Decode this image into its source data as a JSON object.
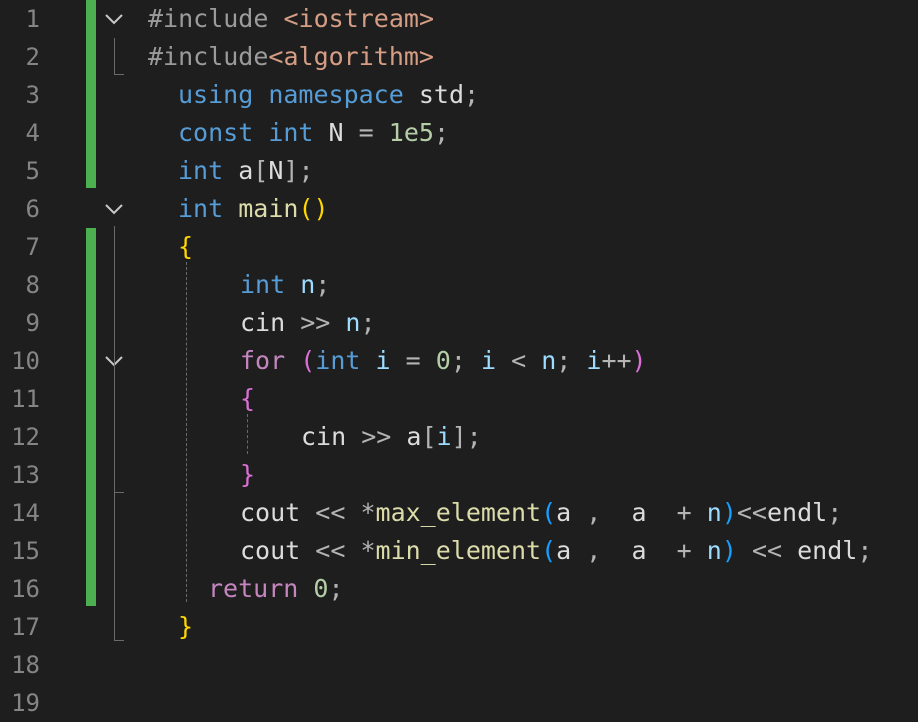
{
  "editor": {
    "line_numbers": [
      "1",
      "2",
      "3",
      "4",
      "5",
      "6",
      "7",
      "8",
      "9",
      "10",
      "11",
      "12",
      "13",
      "14",
      "15",
      "16",
      "17",
      "18",
      "19"
    ]
  },
  "colors": {
    "background": "#1e1e1e",
    "line_number": "#858585",
    "change_bar": "#4caf50",
    "keyword": "#569cd6",
    "control_keyword": "#c586c0",
    "function": "#dcdcaa",
    "variable": "#9cdcfe",
    "number": "#b5cea8",
    "string": "#d69d85",
    "bracket_level1": "#ffd700",
    "bracket_level3": "#179fff"
  },
  "icons": {
    "fold": "chevron-down-icon"
  },
  "code": {
    "l1": {
      "directive": "#include",
      "header": "<iostream>"
    },
    "l2": {
      "directive": "#include",
      "header": "<algorithm>"
    },
    "l3": {
      "kw_using": "using",
      "kw_namespace": "namespace",
      "name": "std",
      "semi": ";"
    },
    "l4": {
      "kw_const": "const",
      "kw_int": "int",
      "name": "N",
      "op": "=",
      "value": "1e5",
      "semi": ";"
    },
    "l5": {
      "kw_int": "int",
      "name": "a",
      "lb": "[",
      "size": "N",
      "rb": "]",
      "semi": ";"
    },
    "l6": {
      "kw_int": "int",
      "fn": "main",
      "parens": "()"
    },
    "l7": {
      "brace": "{"
    },
    "l8": {
      "kw_int": "int",
      "name": "n",
      "semi": ";"
    },
    "l9": {
      "obj": "cin",
      "op": ">>",
      "name": "n",
      "semi": ";"
    },
    "l10": {
      "kw_for": "for",
      "lp": "(",
      "kw_int": "int",
      "i1": "i",
      "eq": "=",
      "zero": "0",
      "semi1": ";",
      "i2": "i",
      "lt": "<",
      "n": "n",
      "semi2": ";",
      "i3": "i",
      "inc": "++",
      "rp": ")"
    },
    "l11": {
      "brace": "{"
    },
    "l12": {
      "obj": "cin",
      "op": ">>",
      "arr": "a",
      "lb": "[",
      "idx": "i",
      "rb": "]",
      "semi": ";"
    },
    "l13": {
      "brace": "}"
    },
    "l14": {
      "obj": "cout",
      "op": "<<",
      "star": "*",
      "fn": "max_element",
      "lp": "(",
      "a1": "a",
      "comma": ",",
      "a2": "a",
      "plus": "+",
      "n": "n",
      "rp": ")",
      "op2": "<<",
      "endl": "endl",
      "semi": ";"
    },
    "l15": {
      "obj": "cout",
      "op": "<<",
      "star": "*",
      "fn": "min_element",
      "lp": "(",
      "a1": "a",
      "comma": ",",
      "a2": "a",
      "plus": "+",
      "n": "n",
      "rp": ")",
      "op2": "<<",
      "endl": "endl",
      "semi": ";"
    },
    "l16": {
      "kw_return": "return",
      "zero": "0",
      "semi": ";"
    },
    "l17": {
      "brace": "}"
    }
  }
}
